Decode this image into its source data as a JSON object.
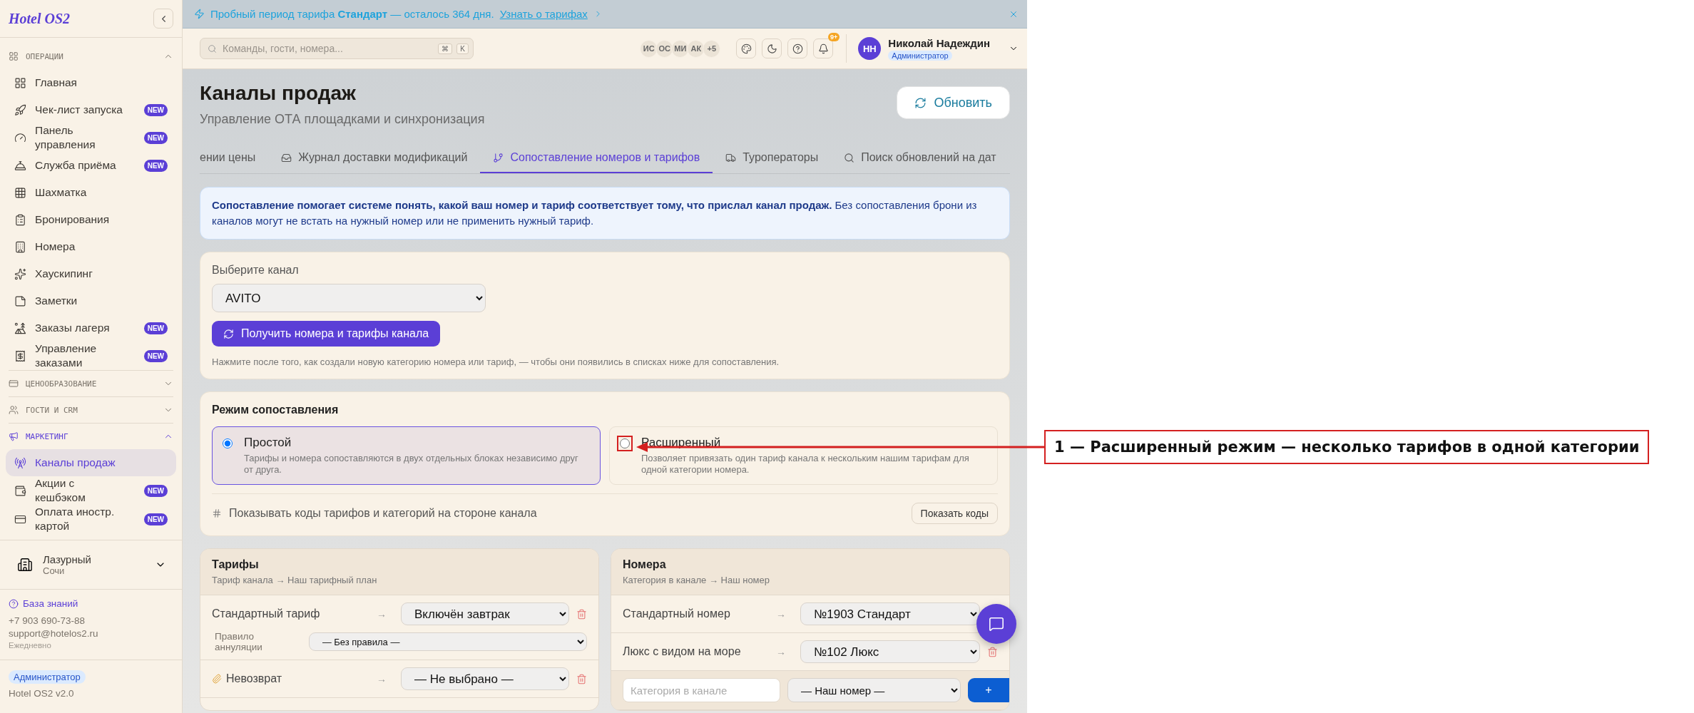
{
  "sidebar": {
    "logo": "Hotel OS2",
    "groups": [
      {
        "title": "ОПЕРАЦИИ",
        "expanded": true,
        "active": false,
        "items": [
          {
            "label": "Главная",
            "selected": false
          },
          {
            "label": "Чек-лист запуска",
            "badge": "NEW",
            "selected": false
          },
          {
            "label": "Панель управления",
            "badge": "NEW",
            "selected": false
          },
          {
            "label": "Служба приёма",
            "badge": "NEW",
            "selected": false
          },
          {
            "label": "Шахматка",
            "selected": false
          },
          {
            "label": "Бронирования",
            "selected": false
          },
          {
            "label": "Номера",
            "selected": false
          },
          {
            "label": "Хаускипинг",
            "selected": false
          },
          {
            "label": "Заметки",
            "selected": false
          },
          {
            "label": "Заказы лагеря",
            "badge": "NEW",
            "selected": false
          },
          {
            "label": "Управление заказами",
            "badge": "NEW",
            "selected": false
          }
        ]
      },
      {
        "title": "ЦЕНООБРАЗОВАНИЕ",
        "expanded": false,
        "active": false
      },
      {
        "title": "ГОСТИ И CRM",
        "expanded": false,
        "active": false
      },
      {
        "title": "МАРКЕТИНГ",
        "expanded": true,
        "active": true,
        "items": [
          {
            "label": "Каналы продаж",
            "selected": true
          },
          {
            "label": "Акции с кешбэком",
            "badge": "NEW",
            "selected": false
          },
          {
            "label": "Оплата иностр. картой",
            "badge": "NEW",
            "selected": false
          }
        ]
      }
    ],
    "property": {
      "name": "Лазурный",
      "city": "Сочи"
    },
    "support": {
      "link": "База знаний",
      "phone": "+7 903 690-73-88",
      "email": "support@hotelos2.ru",
      "hours": "Ежедневно"
    },
    "role": "Администратор",
    "version": "Hotel OS2 v2.0"
  },
  "banner": {
    "text": "Пробный период тарифа **Стандарт** — осталось 364 дня.",
    "link": "Узнать о тарифах"
  },
  "header": {
    "search": {
      "placeholder": "Команды, гости, номера...",
      "keys": [
        "⌘",
        "K"
      ]
    },
    "online_users": [
      "ИС",
      "ОС",
      "МИ",
      "АК",
      "+5"
    ],
    "notifications": "9+",
    "user": {
      "initials": "НН",
      "name": "Николай Надеждин",
      "role": "Администратор"
    }
  },
  "page": {
    "title": "Каналы продаж",
    "subtitle": "Управление ОТА площадками и синхронизация",
    "refresh": "Обновить",
    "tabs": [
      {
        "label": "ении цены",
        "selected": false
      },
      {
        "label": "Журнал доставки модификаций",
        "selected": false
      },
      {
        "label": "Сопоставление номеров и тарифов",
        "selected": true
      },
      {
        "label": "Туроператоры",
        "selected": false
      },
      {
        "label": "Поиск обновлений на дат",
        "selected": false
      }
    ],
    "info": "**Сопоставление помогает системе понять, какой ваш номер и тариф соответствует тому, что прислал канал продаж.** Без сопоставления брони из каналов могут не встать на нужный номер или не применить нужный тариф.",
    "channel": {
      "label": "Выберите канал",
      "value": "AVITO",
      "fetch": "Получить номера и тарифы канала",
      "hint": "Нажмите после того, как создали новую категорию номера или тариф, — чтобы они появились в списках ниже для сопоставления."
    },
    "mode": {
      "title": "Режим сопоставления",
      "options": [
        {
          "title": "Простой",
          "description": "Тарифы и номера сопоставляются в двух отдельных блоках независимо друг от друга.",
          "selected": true,
          "highlighted": false
        },
        {
          "title": "Расширенный",
          "description": "Позволяет привязать один тариф канала к нескольким нашим тарифам для одной категории номера.",
          "selected": false,
          "highlighted": true
        }
      ],
      "codes_label": "Показывать коды тарифов и категорий на стороне канала",
      "codes_button": "Показать коды"
    },
    "rates": {
      "title": "Тарифы",
      "subtitle": "Тариф канала → Наш тарифный план",
      "rows": [
        {
          "kind": "plain",
          "name": "Стандартный тариф",
          "arrow": "→",
          "value": "Включён завтрак",
          "cancel_label": "Правило аннуляции",
          "cancel_value": "— Без правила —"
        },
        {
          "kind": "tagged",
          "name": "Невозврат",
          "arrow": "→",
          "value": "— Не выбрано —"
        }
      ]
    },
    "rooms": {
      "title": "Номера",
      "subtitle": "Категория в канале → Наш номер",
      "rows": [
        {
          "name": "Стандартный номер",
          "arrow": "→",
          "value": "№1903 Стандарт"
        },
        {
          "name": "Люкс с видом на море",
          "arrow": "→",
          "value": "№102 Люкс"
        }
      ],
      "new_placeholder": "Категория в канале",
      "new_value": "— Наш номер —",
      "add": "+"
    }
  },
  "annotation": {
    "text": "1 — Расширенный режим — несколько тарифов в одной категории"
  }
}
